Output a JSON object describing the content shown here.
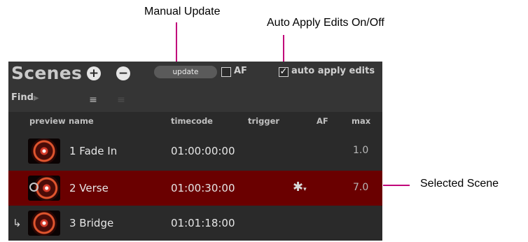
{
  "annotations": {
    "manual_update": "Manual Update",
    "auto_apply": "Auto Apply Edits On/Off",
    "selected_scene": "Selected Scene"
  },
  "panel": {
    "title": "Scenes",
    "add_symbol": "+",
    "remove_symbol": "−",
    "update_label": "update",
    "af_checkbox": {
      "label": "AF",
      "checked": false
    },
    "auto_apply_checkbox": {
      "label": "auto apply edits",
      "checked": true,
      "mark": "✓"
    },
    "find_label": "Find",
    "find_arrow": "▶",
    "filter_icon": "≡",
    "list_icon": "≡",
    "columns": {
      "preview": "preview",
      "name": "name",
      "timecode": "timecode",
      "trigger": "trigger",
      "af": "AF",
      "max": "max"
    },
    "rows": [
      {
        "name": "1 Fade In",
        "timecode": "01:00:00:00",
        "trigger": "",
        "max": "1.0",
        "selected": false
      },
      {
        "name": "2 Verse",
        "timecode": "01:00:30:00",
        "trigger": "gear-icon",
        "max": "7.0",
        "selected": true
      },
      {
        "name": "3 Bridge",
        "timecode": "01:01:18:00",
        "trigger": "",
        "max": "",
        "selected": false,
        "indent_mark": "↳"
      }
    ]
  },
  "colors": {
    "panel_bg": "#2a2a2a",
    "header_bg": "#353535",
    "selected_row": "#6a0000",
    "callout_line": "#c1007a"
  }
}
